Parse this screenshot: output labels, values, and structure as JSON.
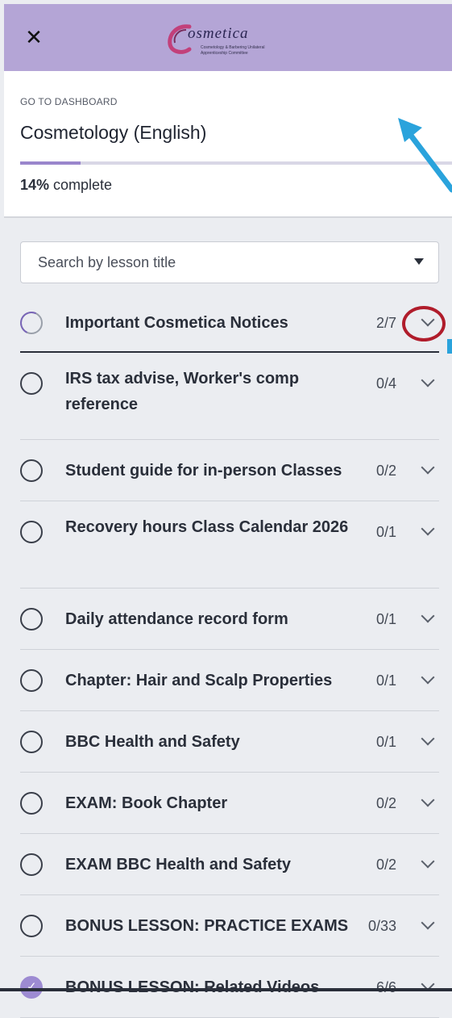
{
  "header": {
    "logo_word": "osmetica",
    "logo_tagline_1": "Cosmetology & Barbering Unilateral",
    "logo_tagline_2": "Apprenticeship Committee"
  },
  "course": {
    "goto_label": "GO TO DASHBOARD",
    "title": "Cosmetology (English)",
    "progress_percent": 14,
    "progress_value": "14%",
    "progress_suffix": " complete"
  },
  "search": {
    "placeholder": "Search by lesson title"
  },
  "colors": {
    "topbar": "#b4a5d6",
    "accent": "#9a86cc",
    "highlight_ring": "#b01c2b",
    "annotation_arrow": "#2aa3dc"
  },
  "lessons": [
    {
      "title": "Important Cosmetica Notices",
      "count": "2/7",
      "status": "partial"
    },
    {
      "title": "IRS tax advise, Worker's comp reference",
      "count": "0/4",
      "status": "empty"
    },
    {
      "title": "Student guide for in-person Classes",
      "count": "0/2",
      "status": "empty"
    },
    {
      "title": "Recovery hours Class Calendar 2026",
      "count": "0/1",
      "status": "empty"
    },
    {
      "title": "Daily attendance record form",
      "count": "0/1",
      "status": "empty"
    },
    {
      "title": "Chapter: Hair and Scalp Properties",
      "count": "0/1",
      "status": "empty"
    },
    {
      "title": "BBC Health and Safety",
      "count": "0/1",
      "status": "empty"
    },
    {
      "title": "EXAM: Book Chapter",
      "count": "0/2",
      "status": "empty"
    },
    {
      "title": "EXAM BBC Health and Safety",
      "count": "0/2",
      "status": "empty"
    },
    {
      "title": "BONUS LESSON: PRACTICE EXAMS",
      "count": "0/33",
      "status": "empty"
    },
    {
      "title": "BONUS LESSON: Related Videos",
      "count": "6/6",
      "status": "done"
    }
  ]
}
